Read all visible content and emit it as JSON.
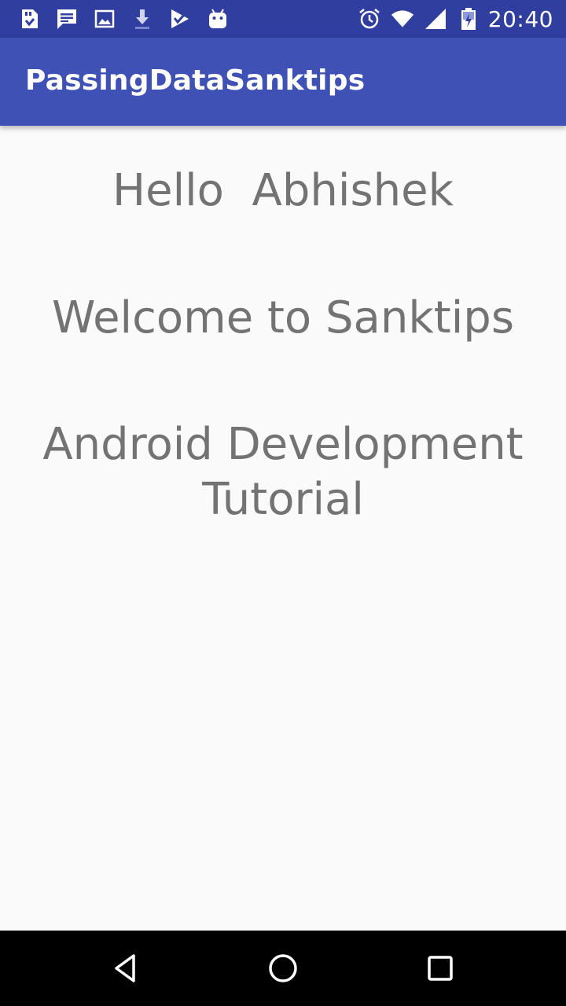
{
  "status_bar": {
    "time": "20:40",
    "left_icons": [
      "sd-card-save-icon",
      "message-icon",
      "image-icon",
      "download-icon",
      "check-app-icon",
      "android-icon"
    ],
    "right_icons": [
      "alarm-icon",
      "wifi-icon",
      "signal-icon",
      "battery-charging-icon"
    ],
    "background": "#303f9f"
  },
  "app_bar": {
    "title": "PassingDataSanktips",
    "background": "#3f51b5"
  },
  "content": {
    "greeting": "Hello  Abhishek",
    "welcome": "Welcome to Sanktips",
    "tutorial": "Android Development Tutorial",
    "text_color": "#737373"
  },
  "nav_bar": {
    "buttons": [
      "back-icon",
      "home-icon",
      "recents-icon"
    ]
  }
}
